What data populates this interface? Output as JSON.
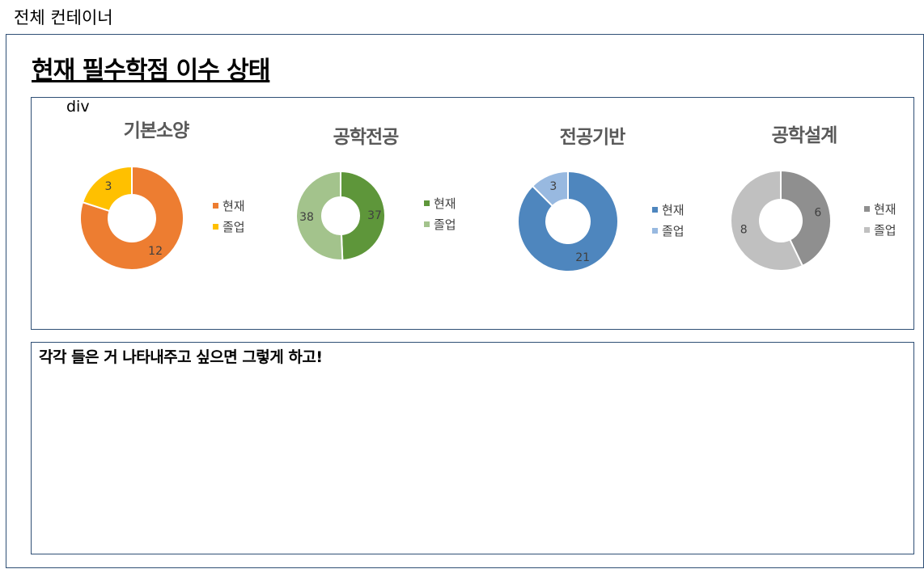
{
  "caption": "전체 컨테이너",
  "title": "현재 필수학점 이수 상태",
  "div_label": "div",
  "note": "각각 들은 거 나타내주고 싶으면 그렇게 하고!",
  "chart_data": [
    {
      "type": "pie",
      "donut": true,
      "title": "기본소양",
      "categories": [
        "현재",
        "졸업"
      ],
      "values": [
        12,
        3
      ],
      "colors": [
        "#ed7d31",
        "#ffc000"
      ]
    },
    {
      "type": "pie",
      "donut": true,
      "title": "공학전공",
      "categories": [
        "현재",
        "졸업"
      ],
      "values": [
        37,
        38
      ],
      "colors": [
        "#5e963a",
        "#a3c38c"
      ]
    },
    {
      "type": "pie",
      "donut": true,
      "title": "전공기반",
      "categories": [
        "현재",
        "졸업"
      ],
      "values": [
        21,
        3
      ],
      "colors": [
        "#4e86be",
        "#98b9e0"
      ]
    },
    {
      "type": "pie",
      "donut": true,
      "title": "공학설계",
      "categories": [
        "현재",
        "졸업"
      ],
      "values": [
        6,
        8
      ],
      "colors": [
        "#8f8f8f",
        "#c0c0c0"
      ]
    }
  ]
}
